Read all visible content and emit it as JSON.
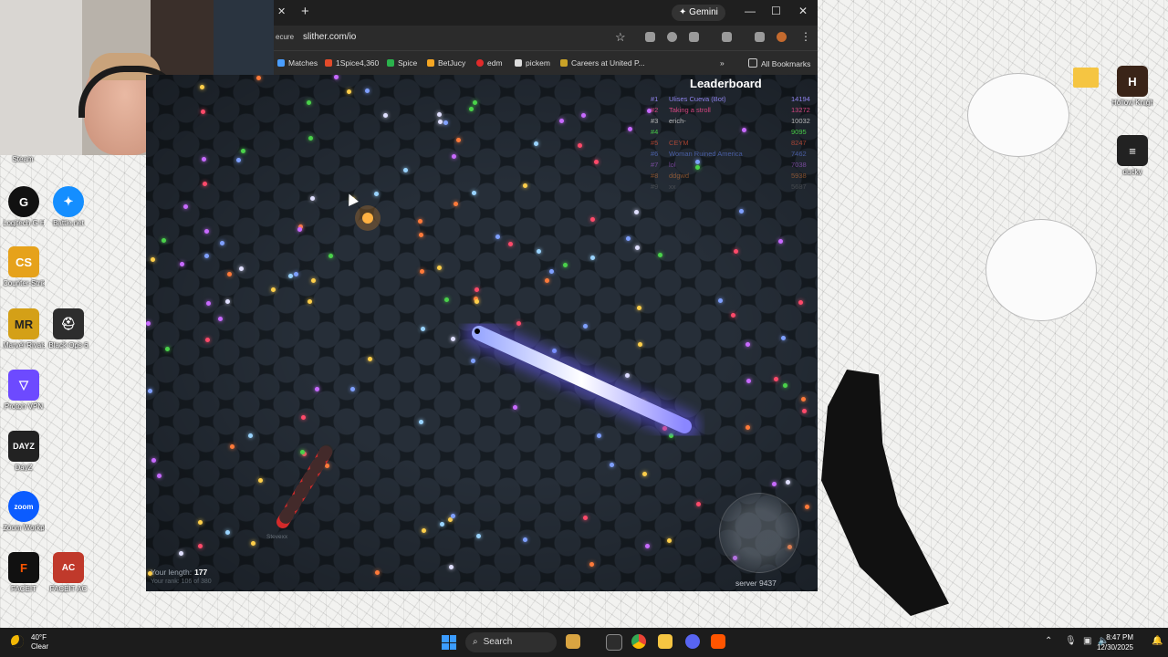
{
  "browser": {
    "gemini_label": "Gemini",
    "secure_label": "ecure",
    "url": "slither.com/io",
    "bookmarks": [
      {
        "label": "Matches",
        "color": "#4a9eff"
      },
      {
        "label": "1Spice4,360",
        "color": "#e34b2a"
      },
      {
        "label": "Spice",
        "color": "#2bb24c"
      },
      {
        "label": "BetJucy",
        "color": "#f5a623"
      },
      {
        "label": "edm",
        "color": "#e02a2a"
      },
      {
        "label": "pickem",
        "color": "#dddddd"
      },
      {
        "label": "Careers at United P...",
        "color": "#c9a227"
      }
    ],
    "all_bookmarks_label": "All Bookmarks"
  },
  "desktop_icons": [
    {
      "label": "Steam",
      "icon": "steam-icon",
      "color": "#1b2838"
    },
    {
      "label": "Logitech G HUB",
      "icon": "logitech-g-icon",
      "color": "#111111",
      "glyph": "G"
    },
    {
      "label": "Battle.net",
      "icon": "battlenet-icon",
      "color": "#148eff",
      "glyph": "✦"
    },
    {
      "label": "Counter-Strike 2",
      "icon": "counter-strike-icon",
      "color": "#e6a21b",
      "glyph": "CS"
    },
    {
      "label": "Marvel Rivals",
      "icon": "marvel-rivals-icon",
      "color": "#d4a017",
      "glyph": "MR"
    },
    {
      "label": "Black Ops 6",
      "icon": "black-ops-icon",
      "color": "#2d2d2d",
      "glyph": "⛑"
    },
    {
      "label": "Proton VPN",
      "icon": "proton-vpn-icon",
      "color": "#6d4aff",
      "glyph": "▽"
    },
    {
      "label": "DayZ",
      "icon": "dayz-icon",
      "color": "#222222",
      "glyph": "DAYZ"
    },
    {
      "label": "Zoom Workplace",
      "icon": "zoom-icon",
      "color": "#0b5cff",
      "glyph": "zoom"
    },
    {
      "label": "FACEIT",
      "icon": "faceit-icon",
      "color": "#ff5500",
      "glyph": "F"
    },
    {
      "label": "FACEIT AC",
      "icon": "faceit-ac-icon",
      "color": "#c0392b",
      "glyph": "AC"
    },
    {
      "label": "Hollow Knight",
      "icon": "game-icon",
      "color": "#3a2418",
      "glyph": "H"
    },
    {
      "label": "ducky",
      "icon": "ducky-icon",
      "color": "#222222",
      "glyph": "≡"
    }
  ],
  "game": {
    "leaderboard_title": "Leaderboard",
    "leaderboard": [
      {
        "rank": "#1",
        "name": "Ulises Cueva (Bot)",
        "score": "14194"
      },
      {
        "rank": "#2",
        "name": "Taking a stroll",
        "score": "13272"
      },
      {
        "rank": "#3",
        "name": "erich-",
        "score": "10032"
      },
      {
        "rank": "#4",
        "name": "",
        "score": "9095"
      },
      {
        "rank": "#5",
        "name": "CEYM",
        "score": "8247"
      },
      {
        "rank": "#6",
        "name": "Woman Ruined America",
        "score": "7462"
      },
      {
        "rank": "#7",
        "name": "lol",
        "score": "7038"
      },
      {
        "rank": "#8",
        "name": "ddgwd",
        "score": "5938"
      },
      {
        "rank": "#9",
        "name": "xx",
        "score": "5687"
      }
    ],
    "your_length_label": "Your length:",
    "your_length": "177",
    "your_rank": "Your rank: 106 of 380",
    "player_name": "Stevexx",
    "server": "server 9437"
  },
  "taskbar": {
    "temperature": "40°F",
    "weather": "Clear",
    "search_label": "Search",
    "time": "8:47 PM",
    "date": "12/30/2025"
  }
}
